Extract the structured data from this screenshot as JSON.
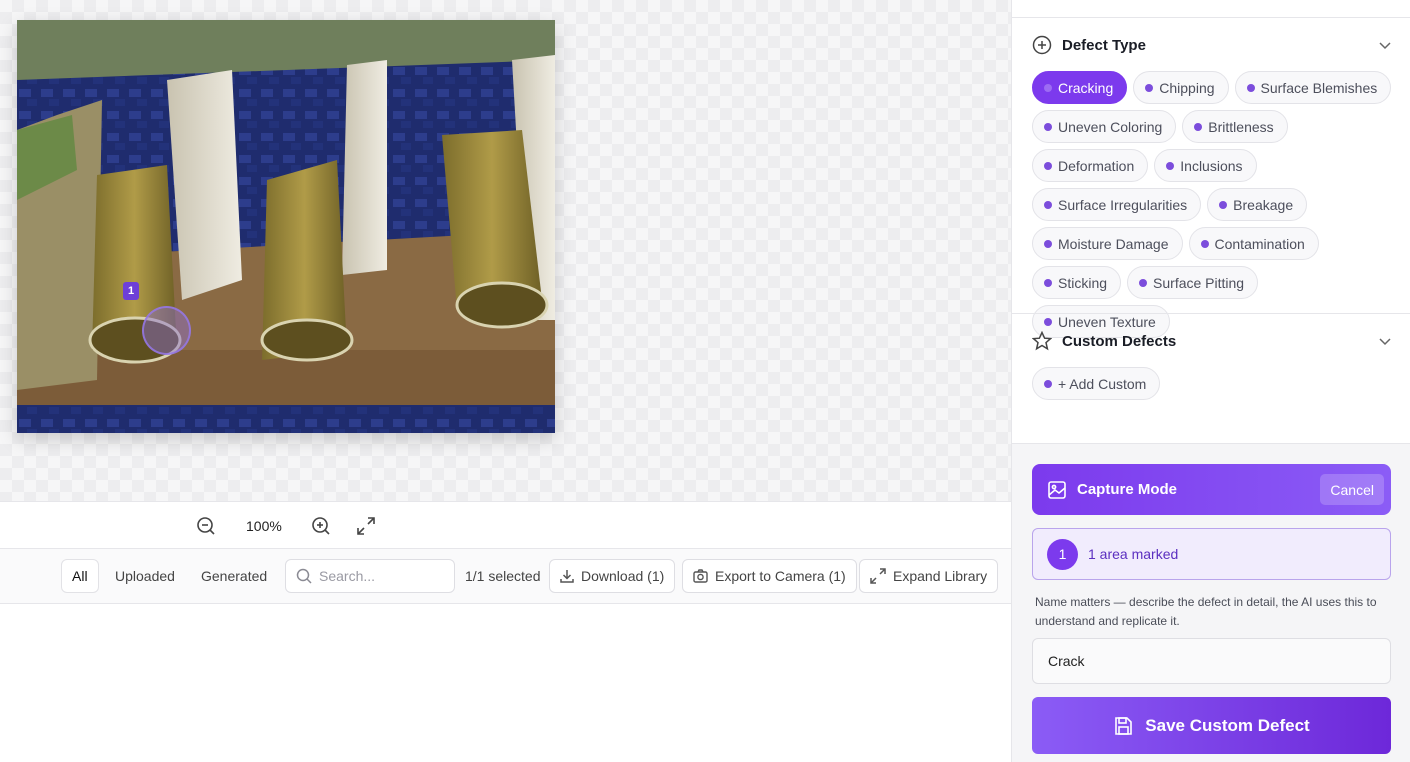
{
  "canvas": {
    "marker_number": "1"
  },
  "zoom": {
    "level": "100%"
  },
  "library": {
    "filters": [
      "All",
      "Uploaded",
      "Generated"
    ],
    "search_placeholder": "Search...",
    "selection": "1/1 selected",
    "download_label": "Download (1)",
    "export_label": "Export to Camera (1)",
    "expand_label": "Expand Library"
  },
  "defect_type": {
    "title": "Defect Type",
    "selected": "Cracking",
    "chips": [
      "Cracking",
      "Chipping",
      "Surface Blemishes",
      "Uneven Coloring",
      "Brittleness",
      "Deformation",
      "Inclusions",
      "Surface Irregularities",
      "Breakage",
      "Moisture Damage",
      "Contamination",
      "Sticking",
      "Surface Pitting",
      "Uneven Texture"
    ]
  },
  "custom_defects": {
    "title": "Custom Defects",
    "add_label": "+ Add Custom"
  },
  "capture": {
    "title": "Capture Mode",
    "cancel_label": "Cancel",
    "marked_count": "1",
    "marked_text": "1 area marked",
    "hint": "Name matters — describe the defect in detail, the AI uses this to understand and replicate it.",
    "name_value": "Crack",
    "save_label": "Save Custom Defect"
  },
  "colors": {
    "accent": "#7c3aed",
    "accent_light": "#f1ecfd"
  }
}
